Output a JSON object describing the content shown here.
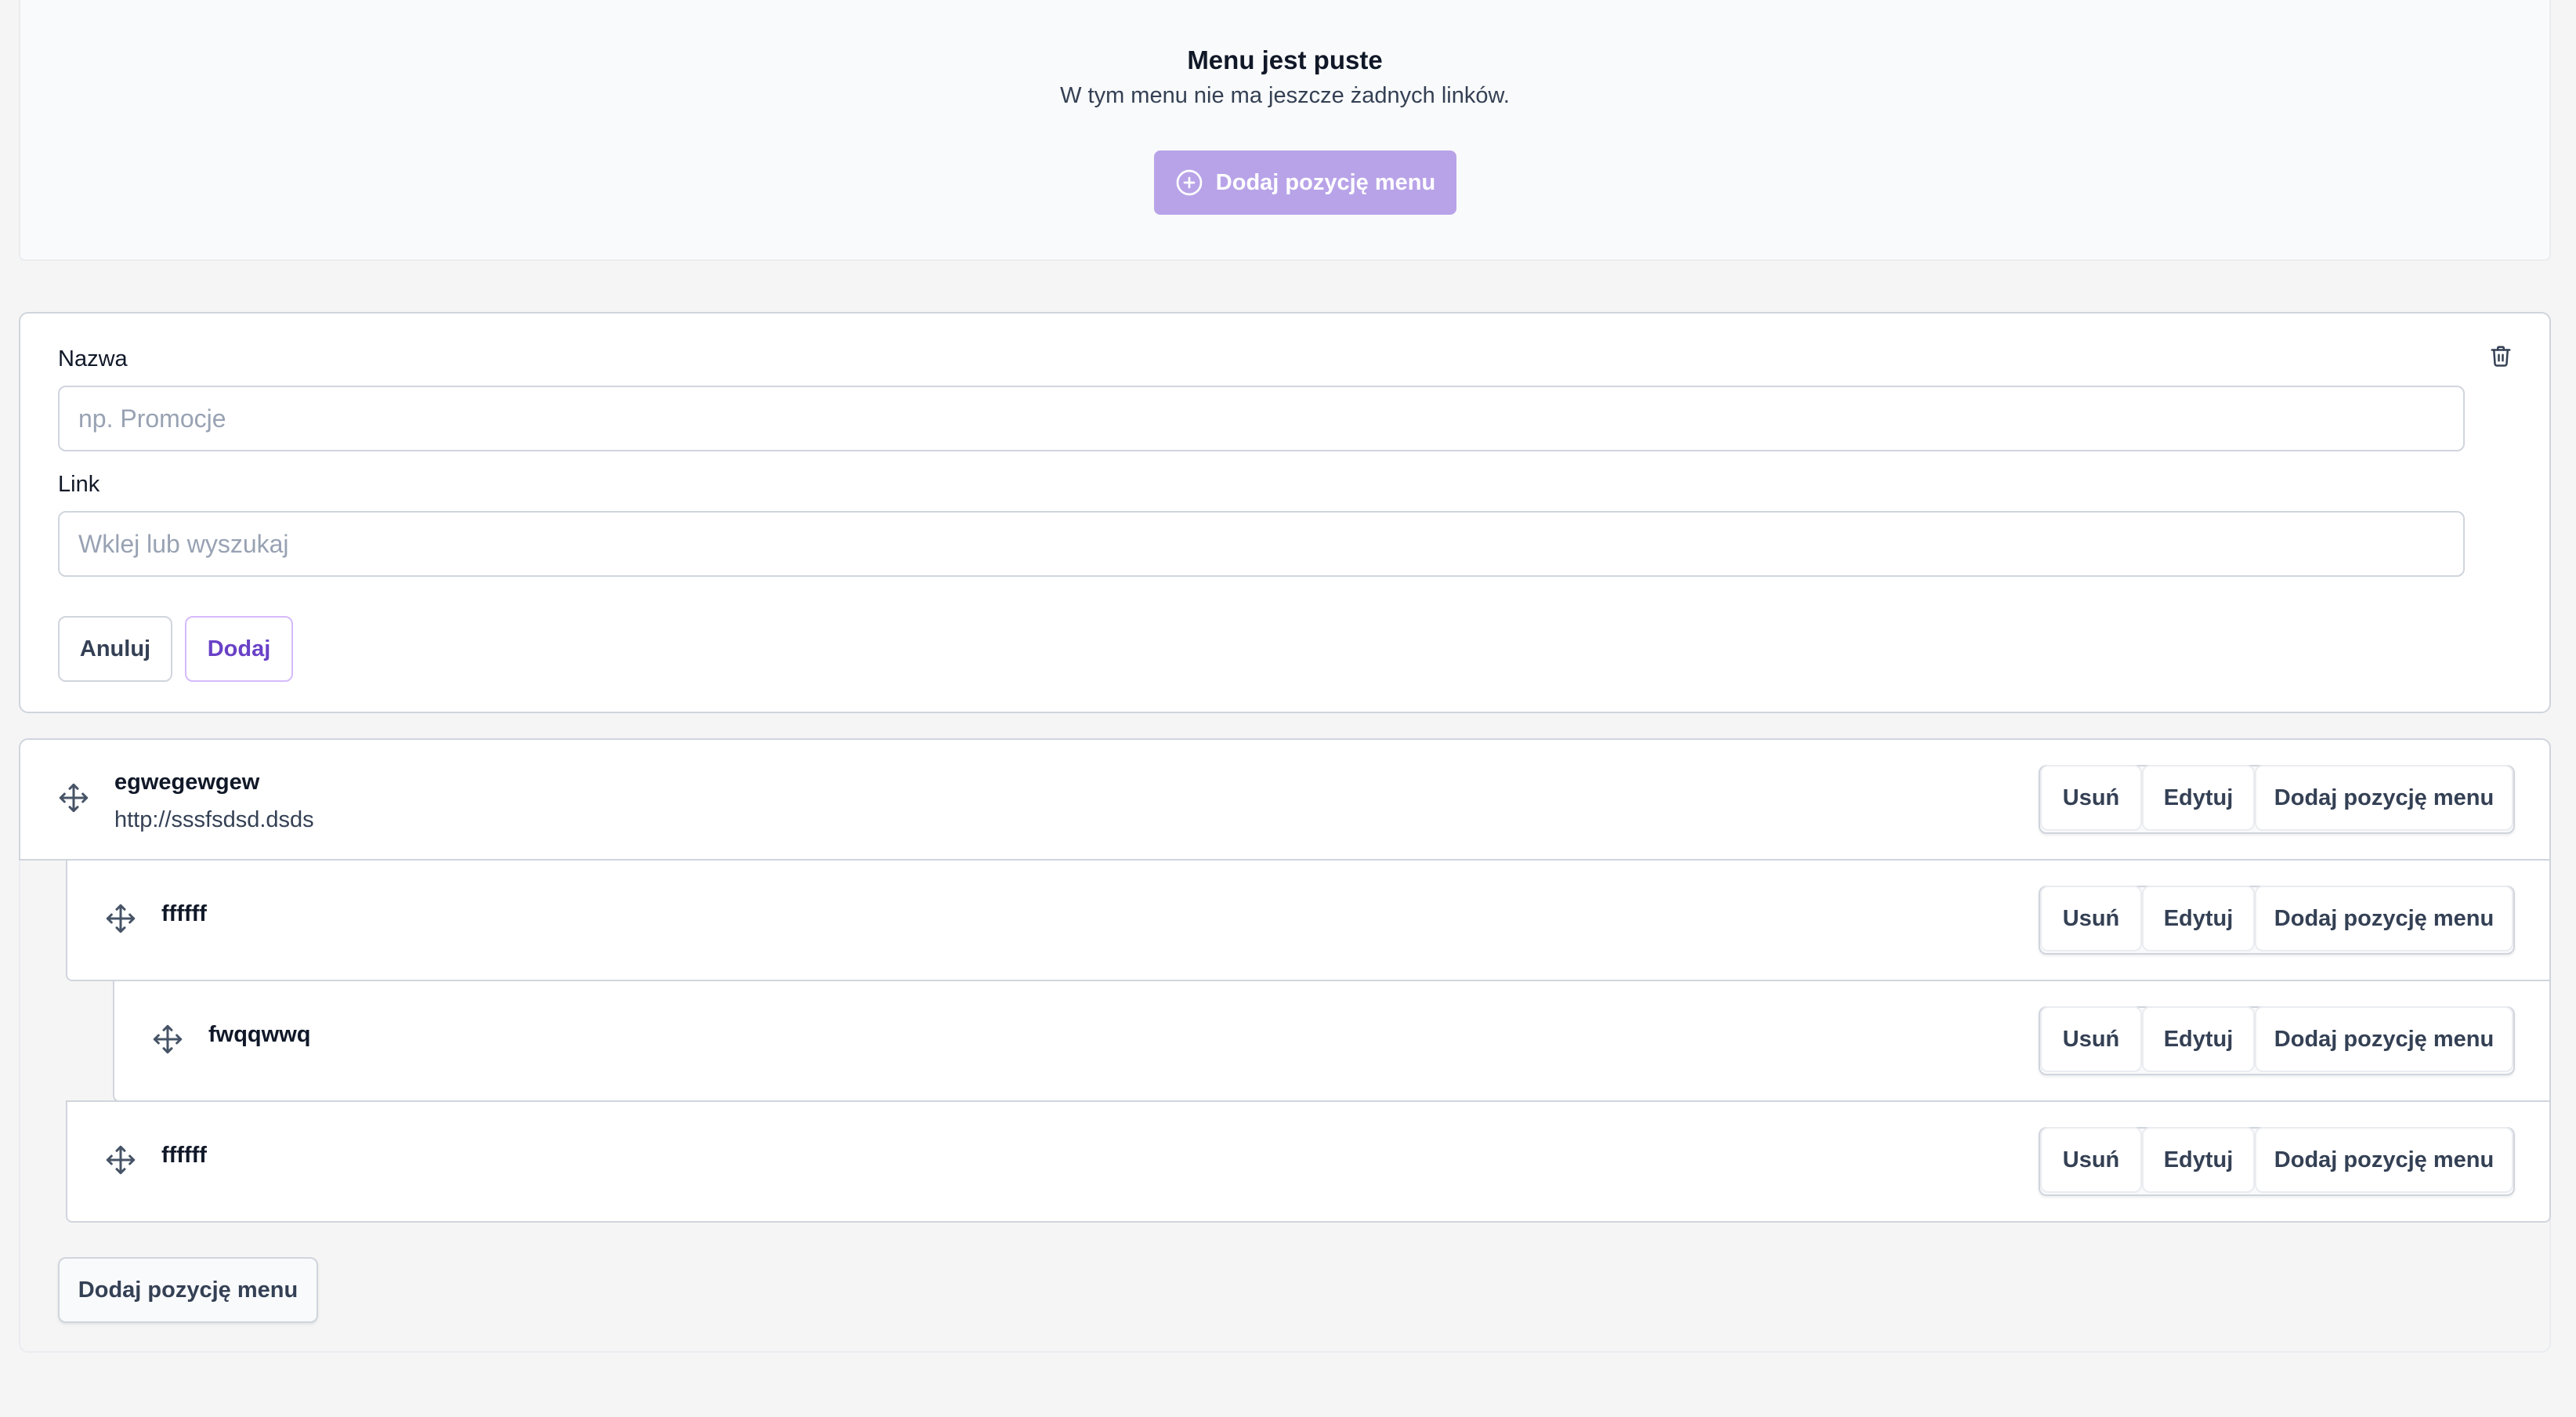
{
  "empty_state": {
    "title": "Menu jest puste",
    "subtitle": "W tym menu nie ma jeszcze żadnych linków.",
    "add_button_label": "Dodaj pozycję menu",
    "add_button_icon": "plus-circle-icon"
  },
  "form": {
    "name_label": "Nazwa",
    "name_placeholder": "np. Promocje",
    "name_value": "",
    "link_label": "Link",
    "link_placeholder": "Wklej lub wyszukaj",
    "link_value": "",
    "cancel_label": "Anuluj",
    "submit_label": "Dodaj",
    "delete_icon": "trash-icon"
  },
  "menu_items": [
    {
      "name": "egwegewgew",
      "url": "http://sssfsdsd.dsds",
      "depth": 0
    },
    {
      "name": "ffffff",
      "url": "",
      "depth": 1
    },
    {
      "name": "fwqqwwq",
      "url": "",
      "depth": 2
    },
    {
      "name": "ffffff",
      "url": "",
      "depth": 1
    }
  ],
  "item_actions": {
    "remove_label": "Usuń",
    "edit_label": "Edytuj",
    "add_label": "Dodaj pozycję menu"
  },
  "bottom_add_label": "Dodaj pozycję menu",
  "colors": {
    "primary": "#b8a3e8",
    "accent_text": "#6941c6",
    "border": "#d0d5dd"
  }
}
